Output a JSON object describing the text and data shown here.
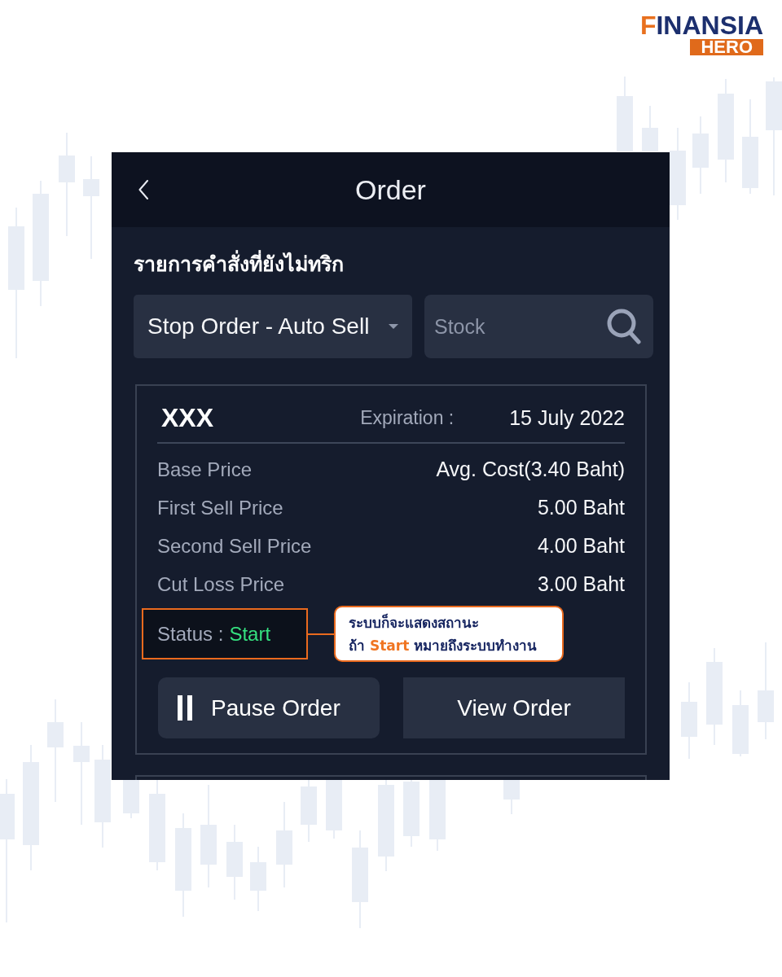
{
  "logo": {
    "wordmark": "FINANSIA",
    "badge": "HERO"
  },
  "background": {
    "kind": "candlesticks"
  },
  "header": {
    "title": "Order"
  },
  "section_title": "รายการคำสั่งที่ยังไม่ทริก",
  "filter": {
    "value": "Stop Order - Auto Sell"
  },
  "search": {
    "placeholder": "Stock"
  },
  "orders": [
    {
      "symbol": "XXX",
      "expiration_label": "Expiration :",
      "expiration": "15 July 2022",
      "rows": [
        {
          "label": "Base Price",
          "value": "Avg. Cost(3.40 Baht)"
        },
        {
          "label": "First Sell Price",
          "value": "5.00 Baht"
        },
        {
          "label": "Second Sell Price",
          "value": "4.00 Baht"
        },
        {
          "label": "Cut Loss Price",
          "value": "3.00 Baht"
        }
      ],
      "status": {
        "label": "Status :",
        "value": "Start"
      },
      "buttons": [
        {
          "kind": "pause",
          "label": "Pause Order"
        },
        {
          "kind": "view",
          "label": "View Order"
        }
      ]
    }
  ],
  "more_orders_below": true,
  "annotation": {
    "text": "ระบบก็จะแสดงสถานะ\nถ้า **Start** หมายถึงระบบทำงาน"
  }
}
